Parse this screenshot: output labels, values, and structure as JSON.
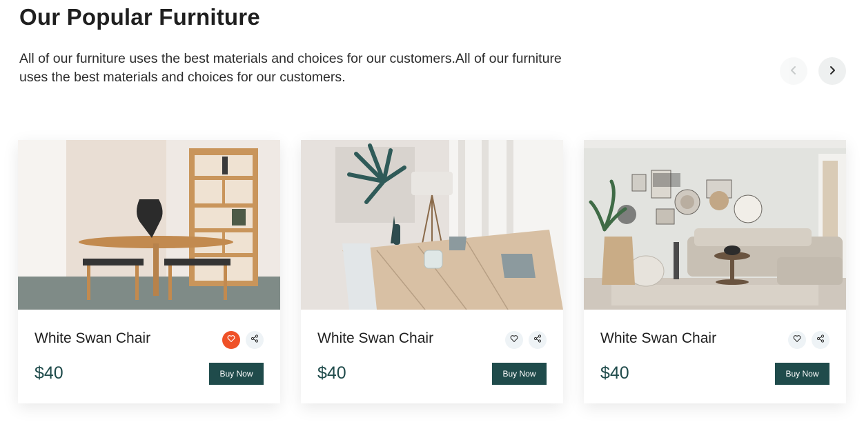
{
  "section": {
    "title": "Our Popular Furniture",
    "description": "All of our furniture uses the best materials and choices for our customers.All of our furniture uses the best materials and choices for our customers."
  },
  "nav": {
    "prev_icon": "chevron-left-icon",
    "next_icon": "chevron-right-icon"
  },
  "colors": {
    "brand": "#1f4b4b",
    "accent": "#ef5127",
    "icon_bg": "#eef3f6"
  },
  "products": [
    {
      "name": "White Swan Chair",
      "price": "$40",
      "button": "Buy Now",
      "favorited": true
    },
    {
      "name": "White Swan Chair",
      "price": "$40",
      "button": "Buy Now",
      "favorited": false
    },
    {
      "name": "White Swan Chair",
      "price": "$40",
      "button": "Buy Now",
      "favorited": false
    }
  ]
}
